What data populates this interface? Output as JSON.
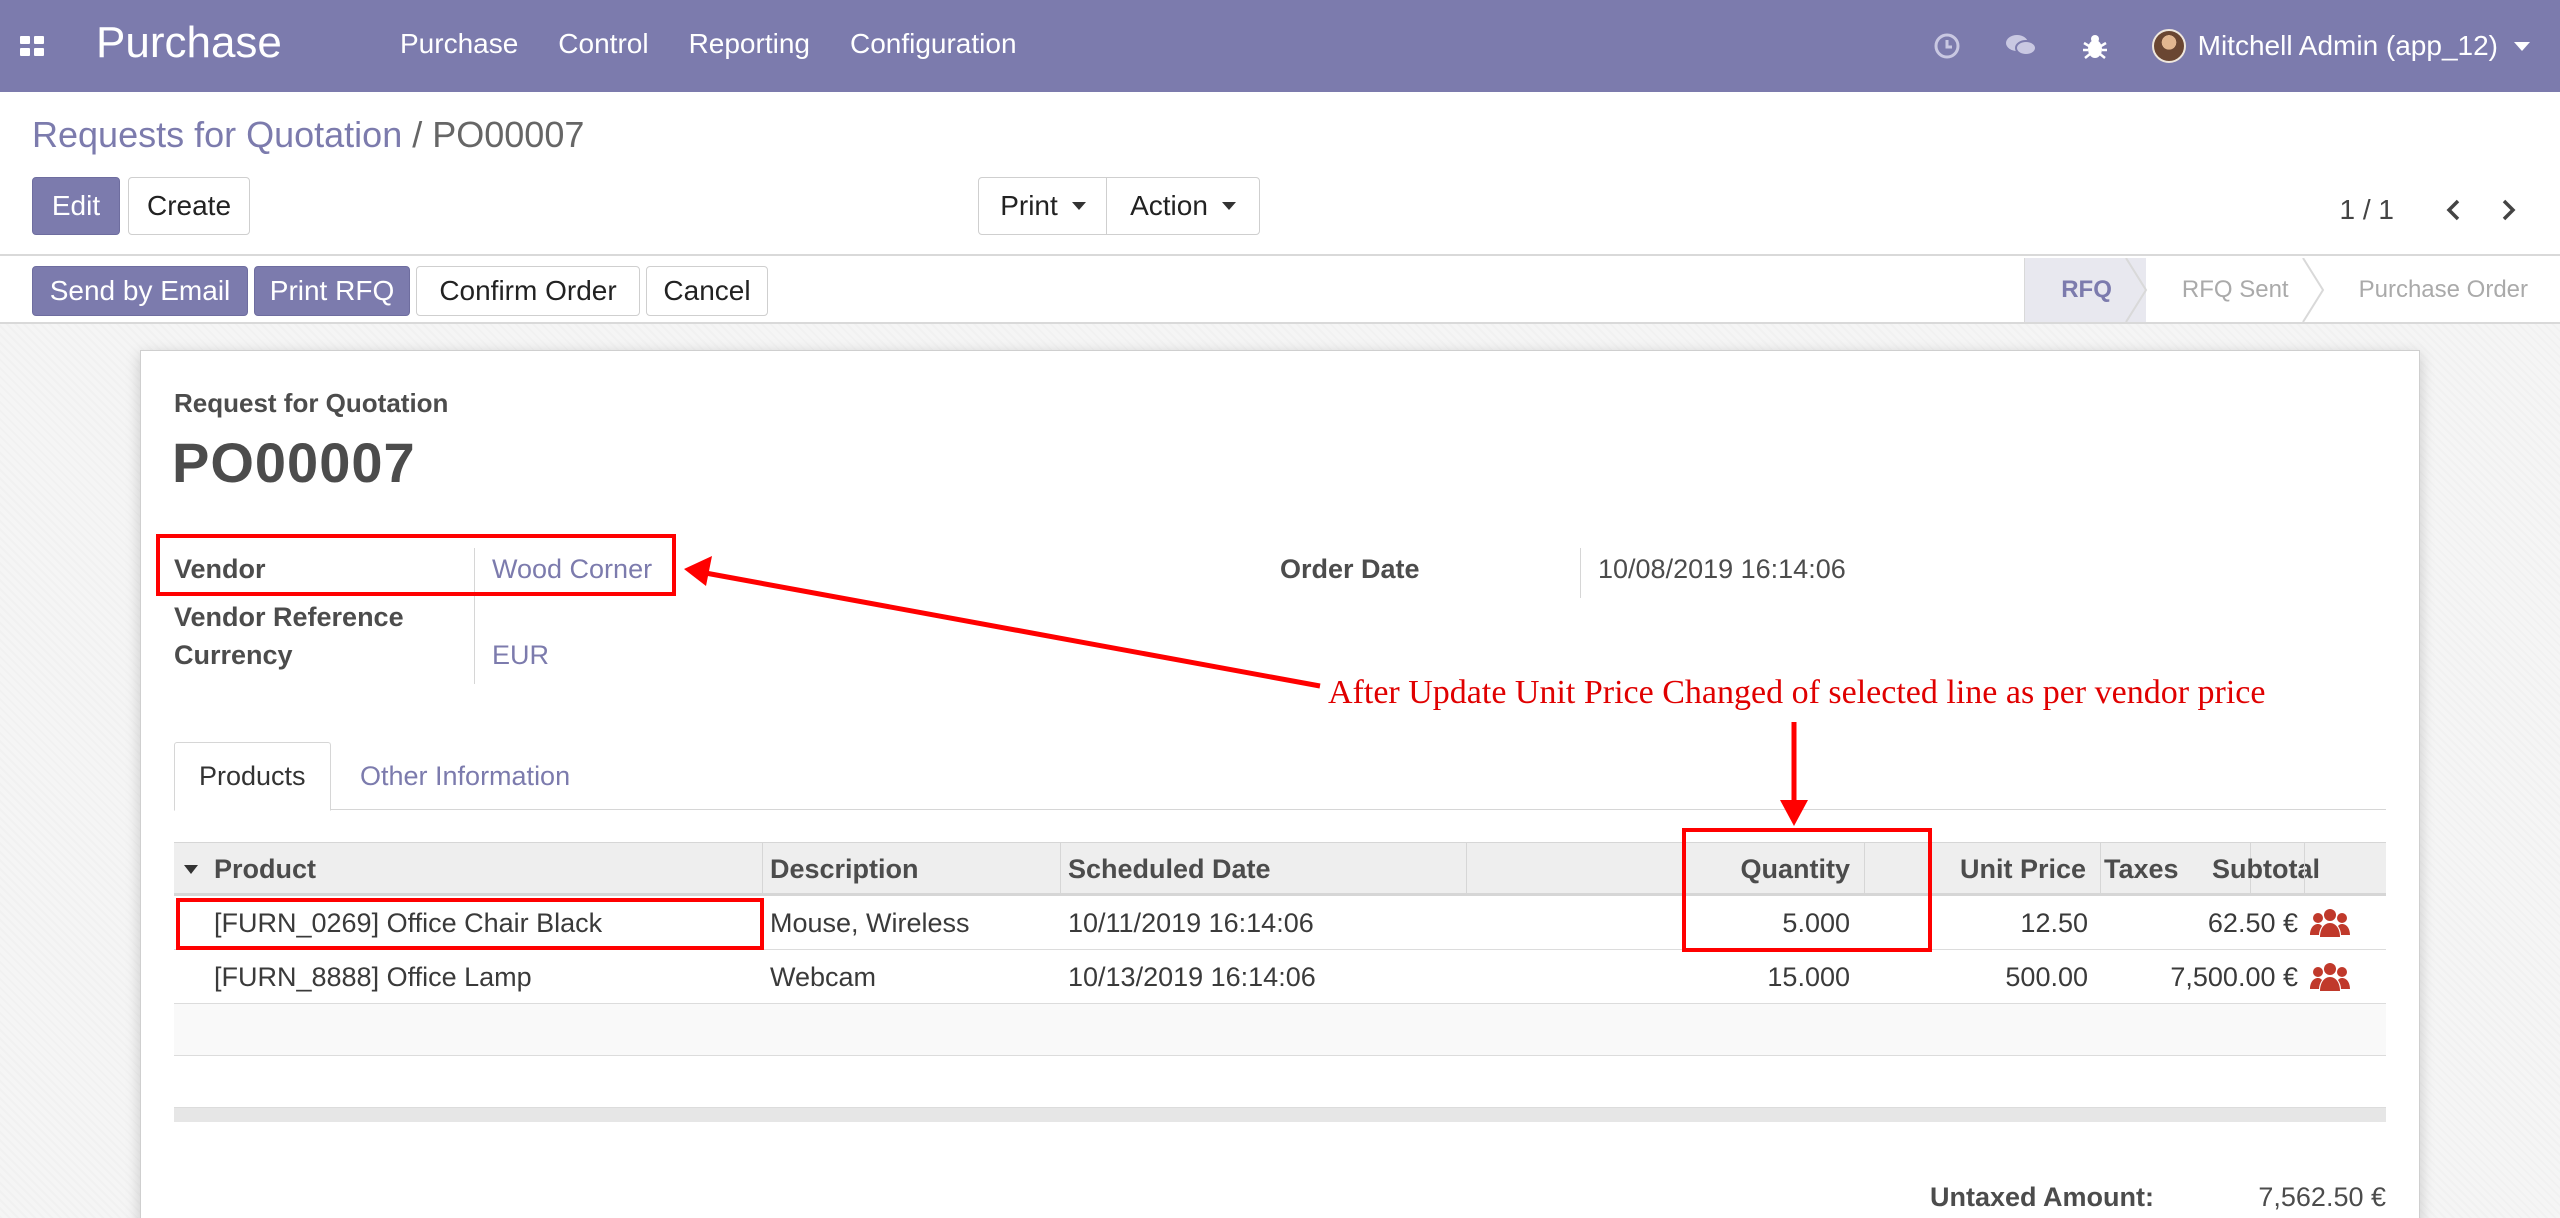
{
  "navbar": {
    "brand": "Purchase",
    "menu": [
      "Purchase",
      "Control",
      "Reporting",
      "Configuration"
    ],
    "user": "Mitchell Admin (app_12)",
    "icons": [
      "apps-icon",
      "clock-icon",
      "chat-icon",
      "bug-icon"
    ],
    "bg_color": "#7c7bad"
  },
  "breadcrumb": {
    "parent": "Requests for Quotation",
    "separator": "/",
    "current": "PO00007"
  },
  "control": {
    "edit_label": "Edit",
    "create_label": "Create",
    "print_label": "Print",
    "action_label": "Action",
    "pager_value": "1 / 1"
  },
  "statusbar": {
    "send_email_label": "Send by Email",
    "print_rfq_label": "Print RFQ",
    "confirm_label": "Confirm Order",
    "cancel_label": "Cancel",
    "stages": [
      "RFQ",
      "RFQ Sent",
      "Purchase Order"
    ],
    "active_stage": "RFQ"
  },
  "document": {
    "subtitle": "Request for Quotation",
    "title": "PO00007",
    "vendor_label": "Vendor",
    "vendor_value": "Wood Corner",
    "vendor_ref_label": "Vendor Reference",
    "currency_label": "Currency",
    "currency_value": "EUR",
    "order_date_label": "Order Date",
    "order_date_value": "10/08/2019 16:14:06"
  },
  "tabs": [
    "Products",
    "Other Information"
  ],
  "table": {
    "columns": [
      "Product",
      "Description",
      "Scheduled Date",
      "Quantity",
      "Unit Price",
      "Taxes",
      "Subtotal"
    ],
    "rows": [
      {
        "product": "[FURN_0269] Office Chair Black",
        "description": "Mouse, Wireless",
        "scheduled": "10/11/2019 16:14:06",
        "quantity": "5.000",
        "unit_price": "12.50",
        "taxes": "",
        "subtotal": "62.50 €"
      },
      {
        "product": "[FURN_8888] Office Lamp",
        "description": "Webcam",
        "scheduled": "10/13/2019 16:14:06",
        "quantity": "15.000",
        "unit_price": "500.00",
        "taxes": "",
        "subtotal": "7,500.00 €"
      }
    ]
  },
  "totals": {
    "untaxed_label": "Untaxed Amount:",
    "untaxed_value": "7,562.50 €"
  },
  "annotation": {
    "text": "After Update Unit Price Changed of selected line as per vendor price",
    "color": "#ff0000"
  }
}
